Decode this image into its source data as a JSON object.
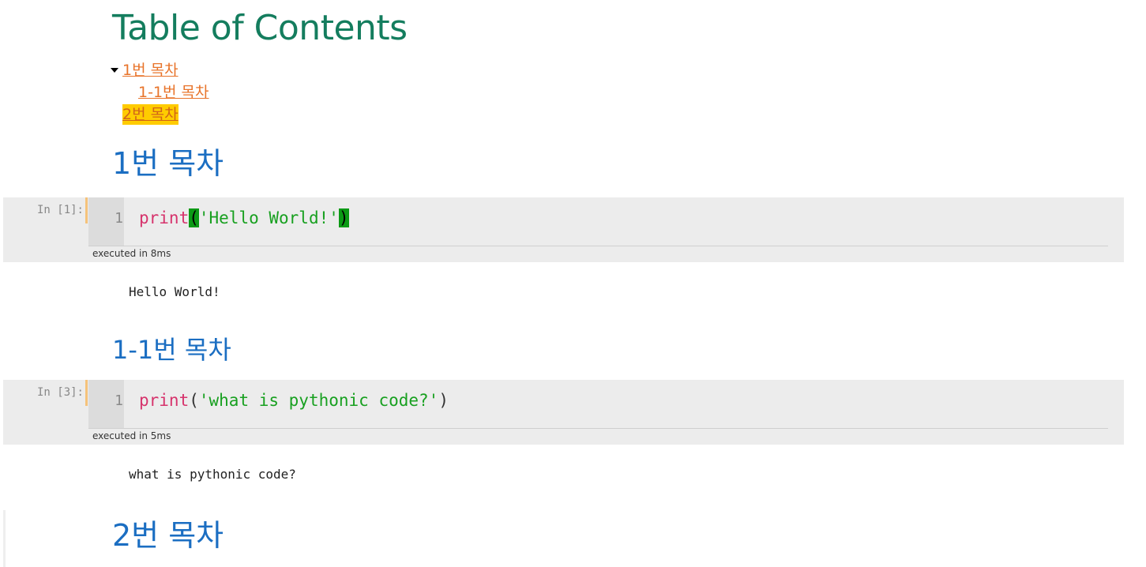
{
  "toc": {
    "title": "Table of Contents",
    "items": [
      {
        "label": "1번 목차"
      },
      {
        "label": "1-1번 목차"
      },
      {
        "label": "2번 목차"
      }
    ]
  },
  "sections": {
    "h1": "1번 목차",
    "h11": "1-1번 목차",
    "h2": "2번 목차"
  },
  "cells": [
    {
      "prompt": "In [1]:",
      "line_number": "1",
      "code_func": "print",
      "code_open": "(",
      "code_string": "'Hello World!'",
      "code_close": ")",
      "exec_time": "executed in 8ms",
      "output": "Hello World!"
    },
    {
      "prompt": "In [3]:",
      "line_number": "1",
      "code_func": "print",
      "code_open": "(",
      "code_string": "'what is pythonic code?'",
      "code_close": ")",
      "exec_time": "executed in 5ms",
      "output": "what is pythonic code?"
    }
  ],
  "colors": {
    "toc_title": "#147d5e",
    "toc_link": "#e8742b",
    "toc_highlight": "#ffcc00",
    "heading": "#1b6ec2",
    "keyword": "#d6336c",
    "string": "#18a020",
    "cell_bg": "#ececec"
  }
}
